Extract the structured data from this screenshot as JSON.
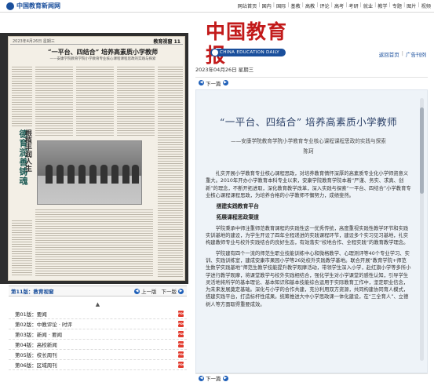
{
  "site": {
    "name": "中国教育新闻网"
  },
  "topnav": [
    "网站首页",
    "国内",
    "国际",
    "基教",
    "高教",
    "评论",
    "高考",
    "考研",
    "就业",
    "教学",
    "专题",
    "图片",
    "视频"
  ],
  "masthead": {
    "title": "中国教育报",
    "subtitle": "CHINA EDUCATION DAILY"
  },
  "right_links": [
    "返回首页",
    "广告刊例"
  ],
  "date": "2023年04月26日 星期三",
  "paper": {
    "header_left": "2023年4月26日 星期三",
    "edition": "教育视窗 11",
    "headline": "“一平台、四结合” 培养高素质小学教师",
    "sub": "——安康学院教育学院小学教育专业核心课程课程思政的实践与探索",
    "side_title": "德育润善铸魂",
    "side_title2": "根植丰润人生"
  },
  "page_bar": {
    "current": "第11版：教育视窗",
    "prev": "上一版",
    "next": "下一版"
  },
  "page_list": [
    "第01版：要闻",
    "第02版：中教评论 · 时评",
    "第03版：新闻 · 要闻",
    "第04版：高校新闻",
    "第05版：校长周刊",
    "第06版：区域周刊"
  ],
  "pdf_label": "PDF",
  "nav": {
    "next_label": "下一篇"
  },
  "article": {
    "title": "“一平台、四结合” 培养高素质小学教师",
    "subtitle": "——安康学院教育学院小学教育专业核心课程课程思政的实践与探索",
    "author": "陈珂",
    "p1": "扎实开展小学教育专业核心课程思政，对培养教育情怀深厚的高素质专业化小学师资意义重大。2010年开办小学教育本科专业以来，安康学院教育学院本着“严谨、务实、求真、创新”的理念，不断开拓进取，深化教育教学改革，深入实践与探索“一平台、四结合”小学教育专业核心课程课程思政，为培养合格的小学教师不懈努力，成绩斐然。",
    "h1": "搭建实践教育平台",
    "h2": "拓展课程思政渠道",
    "p2": "学院秉承中师注重师范教育课程的实践性这一优秀传统，高度重视实践性教学环节和实践实训基地的建设，为学生开设了四年全程递进的实践课程环节，建设多个实习见习基地，扎实构建教师专业与校外实践结合的良好生态，有效落实“校地合作、全程实践”的教育教学理念。",
    "p3": "学院建有四个一流的师范生职业技能训练中心和微格教学、心理测评等40个专业学习、实训、实践训练室，建成安康市果园小学等26处校外实践教学基地。联合开展“教育学院+师范生数学实践基地”师范生教学技能提升教学观摩活动，带领学生深入小学，赴红旗小学等多所小学进行教学观摩，将课堂教学与校外实践相结合，强化学生对小学课堂的感性认知，引导学生灵活地将所学的基本理论、基本知识和基本技能综合运用于实际教育工作中，坚定职业信念，为未来发展奠定基础。深化与小学的合作共建，充分利用双方资源，共同构建协同育人模式，搭建实践平台，打造标杆性成果。统筹推进大中小学思政课一体化建设，在“三全育人”、立德树人等方面取得重要成效。"
  },
  "colors": {
    "brand_blue": "#1a4f9c",
    "mast_red": "#c21a1a",
    "article_bg": "#eef3f8"
  }
}
